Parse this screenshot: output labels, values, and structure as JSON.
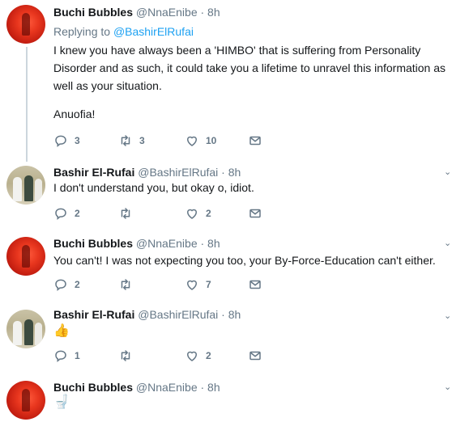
{
  "tweets": [
    {
      "author": "Buchi Bubbles",
      "handle": "@NnaEnibe",
      "time": "· 8h",
      "replying_label": "Replying to",
      "replying_to": "@BashirElRufai",
      "text": "I knew you have always been a 'HIMBO' that is suffering from Personality Disorder and as such, it could take you a lifetime to unravel this information as well as your situation.",
      "text2": "Anuofia!",
      "replies": "3",
      "retweets": "3",
      "likes": "10"
    },
    {
      "author": "Bashir El-Rufai",
      "handle": "@BashirElRufai",
      "time": "· 8h",
      "text": "I don't understand you, but okay o, idiot.",
      "replies": "2",
      "retweets": "",
      "likes": "2"
    },
    {
      "author": "Buchi Bubbles",
      "handle": "@NnaEnibe",
      "time": "· 8h",
      "text": "You can't! I was not expecting you too, your By-Force-Education can't either.",
      "replies": "2",
      "retweets": "",
      "likes": "7"
    },
    {
      "author": "Bashir El-Rufai",
      "handle": "@BashirElRufai",
      "time": "· 8h",
      "text": "👍",
      "replies": "1",
      "retweets": "",
      "likes": "2"
    },
    {
      "author": "Buchi Bubbles",
      "handle": "@NnaEnibe",
      "time": "· 8h",
      "text": "🚽"
    }
  ],
  "colors": {
    "name": "#14171a",
    "meta": "#657786",
    "link": "#1da1f2",
    "thread": "#ccd6dd"
  },
  "icons": [
    "reply-icon",
    "retweet-icon",
    "like-icon",
    "direct-message-icon",
    "caret-down-icon"
  ]
}
